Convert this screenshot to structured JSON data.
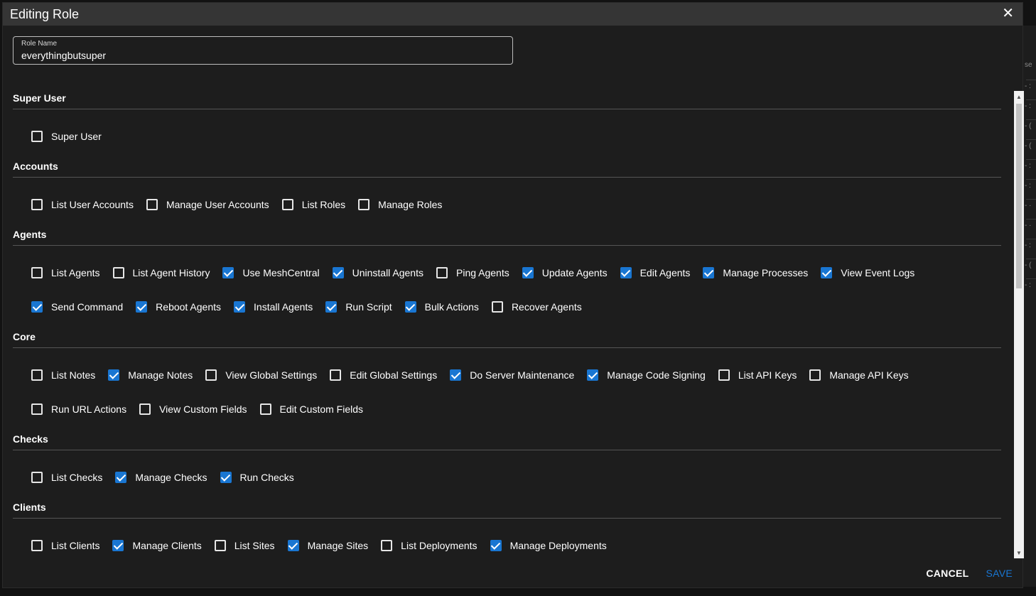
{
  "dialog": {
    "title": "Editing Role",
    "close_icon": "close-icon",
    "role_name_label": "Role Name",
    "role_name_value": "everythingbutsuper",
    "cancel_label": "CANCEL",
    "save_label": "SAVE"
  },
  "background": {
    "header_fragment": "se",
    "row_fragments": [
      "- :",
      "- :",
      "- (",
      "- (",
      "- :",
      "- :",
      "- ·",
      "- ·",
      "- :",
      "- (",
      "- :"
    ]
  },
  "sections": [
    {
      "title": "Super User",
      "rows": [
        [
          {
            "label": "Super User",
            "checked": false
          }
        ]
      ]
    },
    {
      "title": "Accounts",
      "rows": [
        [
          {
            "label": "List User Accounts",
            "checked": false
          },
          {
            "label": "Manage User Accounts",
            "checked": false
          },
          {
            "label": "List Roles",
            "checked": false
          },
          {
            "label": "Manage Roles",
            "checked": false
          }
        ]
      ]
    },
    {
      "title": "Agents",
      "rows": [
        [
          {
            "label": "List Agents",
            "checked": false
          },
          {
            "label": "List Agent History",
            "checked": false
          },
          {
            "label": "Use MeshCentral",
            "checked": true
          },
          {
            "label": "Uninstall Agents",
            "checked": true
          },
          {
            "label": "Ping Agents",
            "checked": false
          },
          {
            "label": "Update Agents",
            "checked": true
          },
          {
            "label": "Edit Agents",
            "checked": true
          },
          {
            "label": "Manage Processes",
            "checked": true
          },
          {
            "label": "View Event Logs",
            "checked": true
          }
        ],
        [
          {
            "label": "Send Command",
            "checked": true
          },
          {
            "label": "Reboot Agents",
            "checked": true
          },
          {
            "label": "Install Agents",
            "checked": true
          },
          {
            "label": "Run Script",
            "checked": true
          },
          {
            "label": "Bulk Actions",
            "checked": true
          },
          {
            "label": "Recover Agents",
            "checked": false
          }
        ]
      ]
    },
    {
      "title": "Core",
      "rows": [
        [
          {
            "label": "List Notes",
            "checked": false
          },
          {
            "label": "Manage Notes",
            "checked": true
          },
          {
            "label": "View Global Settings",
            "checked": false
          },
          {
            "label": "Edit Global Settings",
            "checked": false
          },
          {
            "label": "Do Server Maintenance",
            "checked": true
          },
          {
            "label": "Manage Code Signing",
            "checked": true
          },
          {
            "label": "List API Keys",
            "checked": false
          },
          {
            "label": "Manage API Keys",
            "checked": false
          }
        ],
        [
          {
            "label": "Run URL Actions",
            "checked": false
          },
          {
            "label": "View Custom Fields",
            "checked": false
          },
          {
            "label": "Edit Custom Fields",
            "checked": false
          }
        ]
      ]
    },
    {
      "title": "Checks",
      "rows": [
        [
          {
            "label": "List Checks",
            "checked": false
          },
          {
            "label": "Manage Checks",
            "checked": true
          },
          {
            "label": "Run Checks",
            "checked": true
          }
        ]
      ]
    },
    {
      "title": "Clients",
      "rows": [
        [
          {
            "label": "List Clients",
            "checked": false
          },
          {
            "label": "Manage Clients",
            "checked": true
          },
          {
            "label": "List Sites",
            "checked": false
          },
          {
            "label": "Manage Sites",
            "checked": true
          },
          {
            "label": "List Deployments",
            "checked": false
          },
          {
            "label": "Manage Deployments",
            "checked": true
          }
        ]
      ]
    }
  ]
}
